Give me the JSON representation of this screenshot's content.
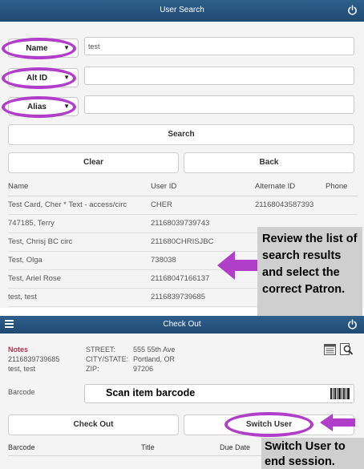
{
  "search_screen": {
    "title": "User Search",
    "rows": [
      {
        "selector": "Name",
        "value": "test"
      },
      {
        "selector": "Alt ID",
        "value": ""
      },
      {
        "selector": "Alias",
        "value": ""
      }
    ],
    "search_label": "Search",
    "clear_label": "Clear",
    "back_label": "Back",
    "columns": [
      "Name",
      "User ID",
      "Alternate ID",
      "Phone"
    ],
    "results": [
      [
        "Test Card, Cher * Text - access/circ",
        "CHER",
        "21168043587393",
        ""
      ],
      [
        "747185, Terry",
        "21168039739743",
        "",
        ""
      ],
      [
        "Test, Chrisj BC circ",
        "211680CHRISJBC",
        "",
        ""
      ],
      [
        "Test, Olga",
        "738038",
        "",
        ""
      ],
      [
        "Test, Ariel Rose",
        "21168047166137",
        "",
        ""
      ],
      [
        "test, test",
        "2116839739685",
        "",
        ""
      ]
    ]
  },
  "callout_review": "Review the list of search results and select the correct Patron.",
  "checkout_screen": {
    "title": "Check Out",
    "notes_label": "Notes",
    "patron_id": "2116839739685",
    "patron_name": "test, test",
    "address": [
      {
        "label": "STREET:",
        "value": "555 55th Ave"
      },
      {
        "label": "CITY/STATE:",
        "value": "Portland, OR"
      },
      {
        "label": "ZIP:",
        "value": "97206"
      }
    ],
    "barcode_label": "Barcode",
    "scan_hint": "Scan item barcode",
    "checkout_label": "Check Out",
    "switch_user_label": "Switch User",
    "columns": [
      "Barcode",
      "Title",
      "Due Date"
    ]
  },
  "callout_switch": "Switch User to end session.",
  "colors": {
    "header_blue": "#2a5885",
    "highlight_oval": "#b13ec9",
    "notes_red": "#c0334a",
    "callout_gray": "#cfcfcf"
  }
}
